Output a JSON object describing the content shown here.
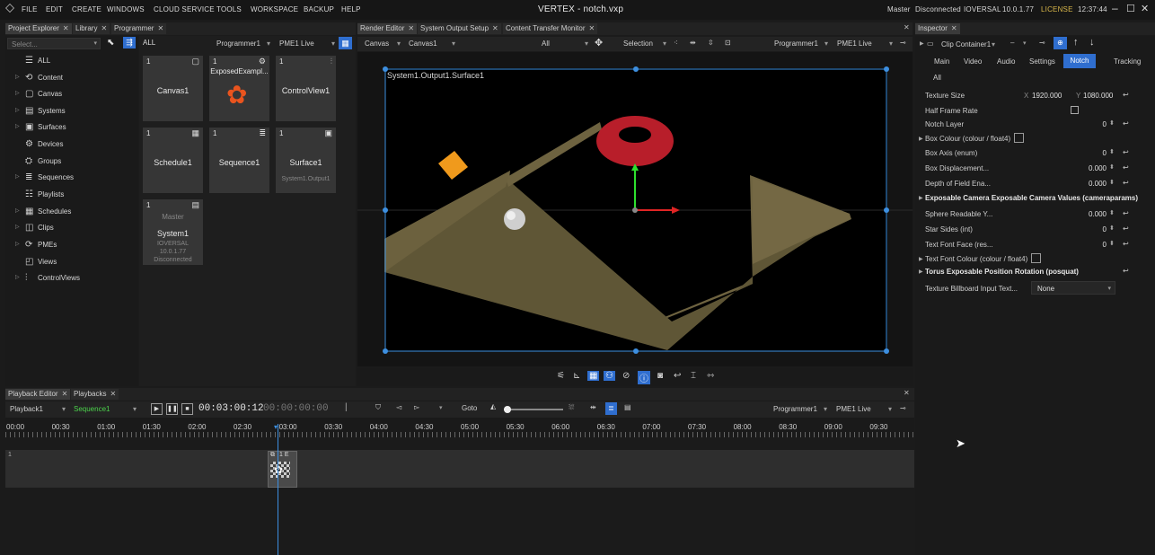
{
  "menu": {
    "items": [
      "FILE",
      "EDIT",
      "CREATE",
      "WINDOWS",
      "CLOUD SERVICE",
      "TOOLS",
      "WORKSPACE",
      "BACKUP",
      "HELP"
    ],
    "title": "VERTEX - notch.vxp",
    "status": {
      "role": "Master",
      "connection": "Disconnected",
      "user": "IOVERSAL",
      "version": "10.0.1.77",
      "license": "LICENSE",
      "clock": "12:37:44"
    }
  },
  "left_tabs": [
    "Project Explorer",
    "Library",
    "Programmer"
  ],
  "explorer": {
    "search_placeholder": "Select...",
    "all_label": "ALL",
    "tree": [
      "ALL",
      "Content",
      "Canvas",
      "Systems",
      "Surfaces",
      "Devices",
      "Groups",
      "Sequences",
      "Playlists",
      "Schedules",
      "Clips",
      "PMEs",
      "Views",
      "ControlViews"
    ]
  },
  "library": {
    "programmer": "Programmer1",
    "pme": "PME1 Live",
    "cards": [
      {
        "num": "1",
        "title": "Canvas1",
        "sub": ""
      },
      {
        "num": "1",
        "title": "ExposedExampl...",
        "sub": ""
      },
      {
        "num": "1",
        "title": "ControlView1",
        "sub": ""
      },
      {
        "num": "1",
        "title": "Schedule1",
        "sub": ""
      },
      {
        "num": "1",
        "title": "Sequence1",
        "sub": ""
      },
      {
        "num": "1",
        "title": "Surface1",
        "sub": "System1.Output1"
      },
      {
        "num": "1",
        "title": "System1",
        "header": "Master",
        "sub1": "IOVERSAL",
        "sub2": "10.0.1.77",
        "sub3": "Disconnected"
      }
    ]
  },
  "render_tabs": [
    "Render Editor",
    "System Output Setup",
    "Content Transfer Monitor"
  ],
  "render": {
    "view_mode": "Canvas",
    "canvas": "Canvas1",
    "filter": "All",
    "tool": "Selection",
    "programmer": "Programmer1",
    "pme": "PME1 Live",
    "surface_label": "System1.Output1.Surface1"
  },
  "inspector": {
    "tab": "Inspector",
    "clip": "Clip Container1",
    "tabs": [
      "Main",
      "Video",
      "Audio",
      "Settings",
      "Notch",
      "Tracking"
    ],
    "active_tab": "Notch",
    "all": "All",
    "props": [
      {
        "label": "Texture Size",
        "x_label": "X",
        "x": "1920.000",
        "y_label": "Y",
        "y": "1080.000"
      },
      {
        "label": "Half Frame Rate",
        "value": ""
      },
      {
        "label": "Notch Layer",
        "value": "0"
      },
      {
        "label": "Box Colour (colour / float4)",
        "value": ""
      },
      {
        "label": "Box Axis (enum)",
        "value": "0"
      },
      {
        "label": "Box Displacement...",
        "value": "0.000"
      },
      {
        "label": "Depth of Field Ena...",
        "value": "0.000"
      },
      {
        "label": "Exposable Camera Exposable Camera Values (cameraparams)",
        "value": ""
      },
      {
        "label": "Sphere Readable Y...",
        "value": "0.000"
      },
      {
        "label": "Star Sides (int)",
        "value": "0"
      },
      {
        "label": "Text Font Face (res...",
        "value": "0"
      },
      {
        "label": "Text Font Colour (colour / float4)",
        "value": ""
      },
      {
        "label": "Torus Exposable Position Rotation (posquat)",
        "value": ""
      },
      {
        "label": "Texture Billboard Input Text...",
        "value": "None"
      }
    ]
  },
  "playback": {
    "tabs": [
      "Playback Editor",
      "Playbacks"
    ],
    "playback": "Playback1",
    "sequence": "Sequence1",
    "time": "00:03:00:12",
    "time2": "00:00:00:00",
    "goto": "Goto",
    "programmer": "Programmer1",
    "pme": "PME1 Live",
    "ticks": [
      "00:00",
      "00:30",
      "01:00",
      "01:30",
      "02:00",
      "02:30",
      "03:00",
      "03:30",
      "04:00",
      "04:30",
      "05:00",
      "05:30",
      "06:00",
      "06:30",
      "07:00",
      "07:30",
      "08:00",
      "08:30",
      "09:00",
      "09:30"
    ],
    "track_num": "1",
    "clip_label": "1 E"
  }
}
